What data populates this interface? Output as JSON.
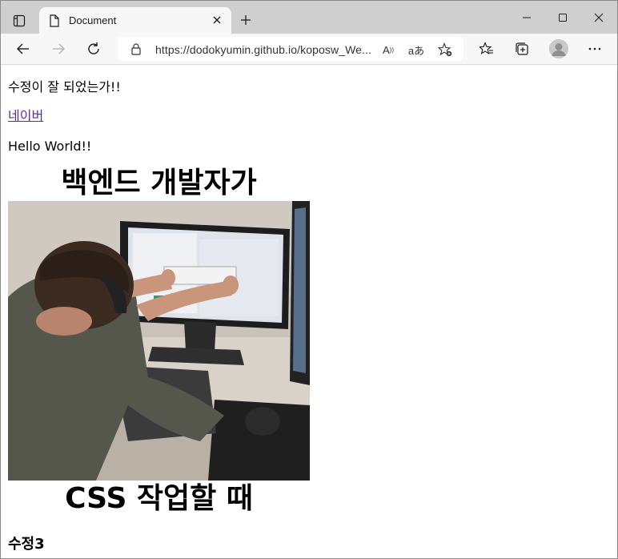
{
  "browser": {
    "tab_title": "Document",
    "url": "https://dodokyumin.github.io/koposw_We...",
    "read_aloud_label": "A",
    "translate_label": "aあ"
  },
  "page": {
    "line1": "수정이 잘 되었는가!!",
    "link_text": "네이버",
    "line3": "Hello World!!",
    "meme_top_text": "백엔드 개발자가",
    "meme_bottom_text": "CSS 작업할 때",
    "heading": "수정3"
  },
  "icons": {
    "tab_actions": "tab-actions-icon",
    "favicon": "document-icon",
    "tab_close": "close-icon",
    "new_tab": "plus-icon",
    "minimize": "minimize-icon",
    "maximize": "maximize-icon",
    "close_window": "close-icon",
    "back": "back-arrow-icon",
    "forward": "forward-arrow-icon",
    "refresh": "refresh-icon",
    "lock": "lock-icon",
    "favorite_add": "star-plus-icon",
    "favorites": "favorites-icon",
    "collections": "collections-icon",
    "profile": "avatar-icon",
    "menu": "more-icon"
  },
  "colors": {
    "titlebar": "#cfcfcf",
    "toolbar": "#f7f7f7",
    "visited_link": "#5c2d91"
  }
}
